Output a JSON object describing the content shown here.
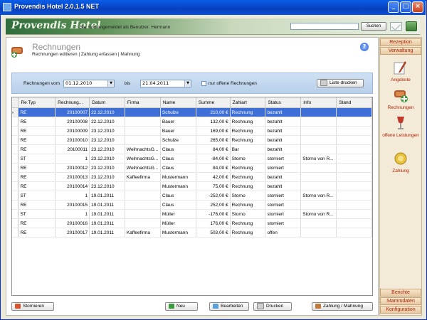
{
  "window": {
    "title": "Provendis Hotel 2.0.1.5 NET"
  },
  "header": {
    "logo": "Provendis Hotel",
    "user_text": "Sie sind angemeldet als Benutzer: Hermann",
    "search_value": "",
    "search_button": "Suchen"
  },
  "page": {
    "title": "Rechnungen",
    "subtitle": "Rechnungen editieren | Zahlung erfassen | Mahnung"
  },
  "filter": {
    "label_from": "Rechnungen vom",
    "date_from": "01.12.2010",
    "label_to": "bis",
    "date_to": "21.04.2011",
    "checkbox_label": "nur offene Rechnungen",
    "print_list": "Liste drucken"
  },
  "table": {
    "columns": [
      "Re Typ",
      "Rechnung...",
      "Datum",
      "Firma",
      "Name",
      "Summe",
      "Zahlart",
      "Status",
      "Info",
      "Stand"
    ],
    "rows": [
      [
        "RE",
        "20100007",
        "22.12.2010",
        "",
        "Schulze",
        "210,00 €",
        "Rechnung",
        "bezahlt",
        "",
        ""
      ],
      [
        "RE",
        "20100008",
        "22.12.2010",
        "",
        "Bauer",
        "132,00 €",
        "Rechnung",
        "bezahlt",
        "",
        ""
      ],
      [
        "RE",
        "20100009",
        "23.12.2010",
        "",
        "Bauer",
        "169,00 €",
        "Rechnung",
        "bezahlt",
        "",
        ""
      ],
      [
        "RE",
        "20100010",
        "23.12.2010",
        "",
        "Schulze",
        "265,00 €",
        "Rechnung",
        "bezahlt",
        "",
        ""
      ],
      [
        "RE",
        "20100011",
        "23.12.2010",
        "WeihnachtsG...",
        "Claus",
        "84,00 €",
        "Bar",
        "bezahlt",
        "",
        ""
      ],
      [
        "ST",
        "1",
        "23.12.2010",
        "WeihnachtsG...",
        "Claus",
        "-84,00 €",
        "Storno",
        "storniert",
        "Storno von R...",
        ""
      ],
      [
        "RE",
        "20100012",
        "23.12.2010",
        "WeihnachtsG...",
        "Claus",
        "84,00 €",
        "Rechnung",
        "storniert",
        "",
        ""
      ],
      [
        "RE",
        "20100013",
        "23.12.2010",
        "Kaffeefirma",
        "Mustermann",
        "42,00 €",
        "Rechnung",
        "bezahlt",
        "",
        ""
      ],
      [
        "RE",
        "20100014",
        "23.12.2010",
        "",
        "Mustermann",
        "75,00 €",
        "Rechnung",
        "bezahlt",
        "",
        ""
      ],
      [
        "ST",
        "1",
        "19.01.2011",
        "",
        "Claus",
        "-252,00 €",
        "Storno",
        "storniert",
        "Storno von R...",
        ""
      ],
      [
        "RE",
        "20100015",
        "19.01.2011",
        "",
        "Claus",
        "252,00 €",
        "Rechnung",
        "storniert",
        "",
        ""
      ],
      [
        "ST",
        "1",
        "19.01.2011",
        "",
        "Müller",
        "-176,00 €",
        "Storno",
        "storniert",
        "Storno von R...",
        ""
      ],
      [
        "RE",
        "20100016",
        "19.01.2011",
        "",
        "Müller",
        "176,00 €",
        "Rechnung",
        "storniert",
        "",
        ""
      ],
      [
        "RE",
        "20100017",
        "19.01.2011",
        "Kaffeefirma",
        "Mustermann",
        "503,00 €",
        "Rechnung",
        "offen",
        "",
        ""
      ]
    ]
  },
  "buttons": {
    "storno": "Stornieren",
    "new": "Neu",
    "edit": "Bearbeiten",
    "print": "Drucken",
    "payment": "Zahlung / Mahnung"
  },
  "sidebar": {
    "top_tabs": [
      "Rezeption",
      "Verwaltung"
    ],
    "items": [
      "Angebote",
      "Rechnungen",
      "offene Leistungen",
      "Zahlung"
    ],
    "bottom_tabs": [
      "Berichte",
      "Stammdaten",
      "Konfiguration"
    ]
  },
  "colors": {
    "selection": "#3d6fd6",
    "accent_red": "#b02000",
    "titlebar": "#0747c9"
  }
}
